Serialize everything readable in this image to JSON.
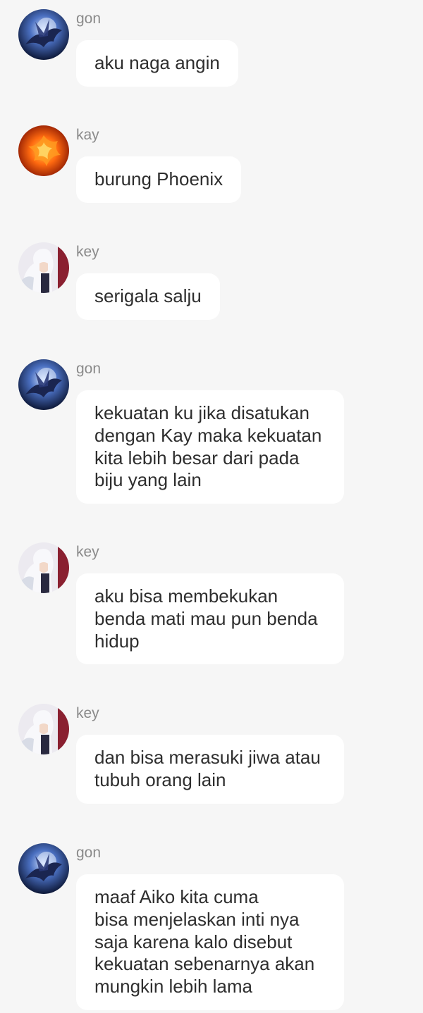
{
  "colors": {
    "background": "#f6f6f6",
    "bubble": "#ffffff",
    "sender_text": "#8a8a8a",
    "message_text": "#2e2e2e"
  },
  "messages": [
    {
      "sender": "gon",
      "avatar": "dragon-avatar-icon",
      "text": "aku naga angin"
    },
    {
      "sender": "kay",
      "avatar": "phoenix-avatar-icon",
      "text": "burung Phoenix"
    },
    {
      "sender": "key",
      "avatar": "snow-wolf-avatar-icon",
      "text": "serigala salju"
    },
    {
      "sender": "gon",
      "avatar": "dragon-avatar-icon",
      "text": "kekuatan ku jika disatukan\ndengan Kay maka kekuatan\nkita lebih besar dari pada\nbiju yang lain"
    },
    {
      "sender": "key",
      "avatar": "snow-wolf-avatar-icon",
      "text": "aku bisa membekukan\nbenda mati mau pun benda\nhidup"
    },
    {
      "sender": "key",
      "avatar": "snow-wolf-avatar-icon",
      "text": "dan bisa merasuki jiwa atau\ntubuh orang lain"
    },
    {
      "sender": "gon",
      "avatar": "dragon-avatar-icon",
      "text": "maaf Aiko kita cuma\nbisa menjelaskan inti nya\nsaja karena kalo disebut\nkekuatan sebenarnya akan\nmungkin lebih lama"
    }
  ]
}
